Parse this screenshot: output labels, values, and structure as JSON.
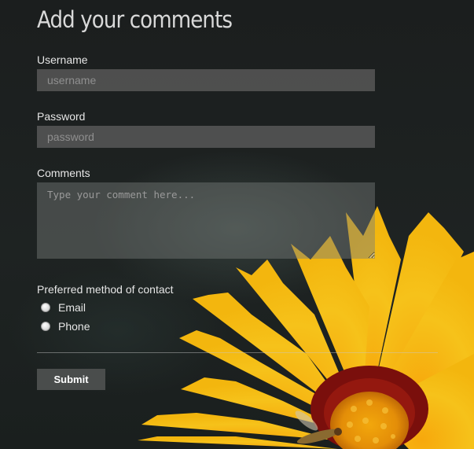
{
  "form": {
    "title": "Add your comments",
    "username": {
      "label": "Username",
      "placeholder": "username",
      "value": ""
    },
    "password": {
      "label": "Password",
      "placeholder": "password",
      "value": ""
    },
    "comments": {
      "label": "Comments",
      "placeholder": "Type your comment here...",
      "value": ""
    },
    "contact": {
      "label": "Preferred method of contact",
      "options": [
        {
          "label": "Email",
          "selected": false
        },
        {
          "label": "Phone",
          "selected": false
        }
      ]
    },
    "submit_label": "Submit"
  },
  "background": {
    "image": "yellow flower with dark red center on a blurred dark background",
    "colors": {
      "petal": "#f2b40f",
      "center": "#7a0f0c",
      "dark": "#1c1f1f"
    }
  }
}
